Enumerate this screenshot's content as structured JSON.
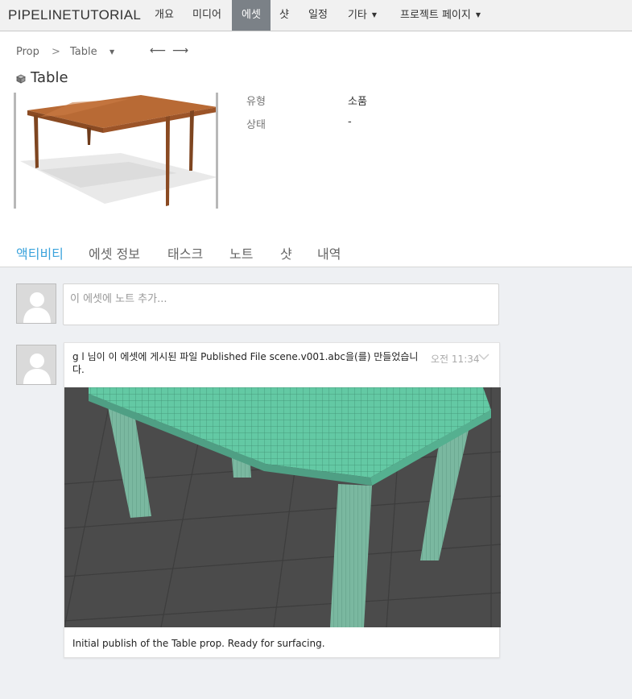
{
  "nav": {
    "brand": "PIPELINETUTORIAL",
    "items": [
      {
        "label": "개요"
      },
      {
        "label": "미디어"
      },
      {
        "label": "에셋"
      },
      {
        "label": "샷"
      },
      {
        "label": "일정"
      },
      {
        "label": "기타",
        "caret": "▼"
      },
      {
        "label": "프로젝트 페이지",
        "caret": "▼"
      }
    ]
  },
  "breadcrumb": {
    "type": "Prop",
    "separator": ">",
    "name": "Table",
    "caret": "▼",
    "prev": "⟵",
    "next": "⟶"
  },
  "asset": {
    "title": "Table",
    "fields": [
      {
        "label": "유형",
        "value": "소품"
      },
      {
        "label": "상태",
        "value": "-"
      }
    ]
  },
  "tabs": [
    "액티비티",
    "에셋 정보",
    "태스크",
    "노트",
    "샷",
    "내역"
  ],
  "activity": {
    "note_placeholder": "이 에셋에 노트 추가...",
    "entry": {
      "text": "g l 님이 이 에셋에 게시된 파일 Published File scene.v001.abc을(를) 만들었습니다.",
      "time_prefix": "오전",
      "time": "11:34",
      "caption": "Initial publish of the Table prop. Ready for surfacing."
    }
  },
  "colors": {
    "accent": "#3aa3dc",
    "nav_active": "#7b8187",
    "wireframe": "#63c9a4"
  }
}
